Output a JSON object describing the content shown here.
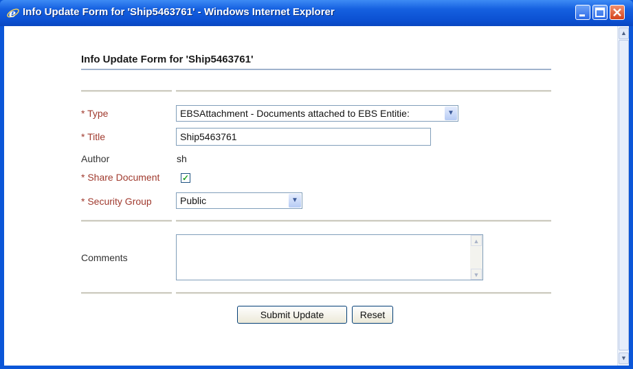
{
  "window": {
    "title": "Info Update Form for 'Ship5463761' - Windows Internet Explorer"
  },
  "form": {
    "heading": "Info Update Form for 'Ship5463761'",
    "type": {
      "label": "* Type",
      "value": "EBSAttachment - Documents attached to EBS Entitie:"
    },
    "title_field": {
      "label": "* Title",
      "value": "Ship5463761"
    },
    "author": {
      "label": "Author",
      "value": "sh"
    },
    "share_document": {
      "label": "* Share Document",
      "checked": true
    },
    "security_group": {
      "label": "* Security Group",
      "value": "Public"
    },
    "comments": {
      "label": "Comments",
      "value": ""
    },
    "buttons": {
      "submit": "Submit Update",
      "reset": "Reset"
    }
  },
  "colors": {
    "required_label": "#a03a2e",
    "titlebar": "#0b56d8"
  }
}
